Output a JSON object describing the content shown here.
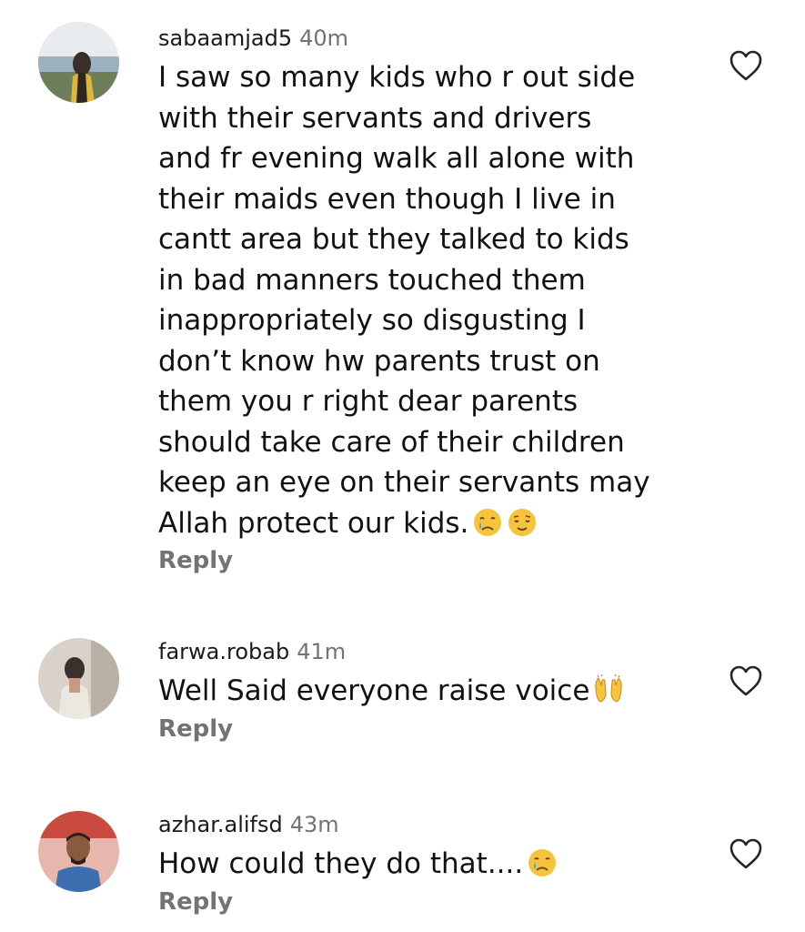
{
  "comments": [
    {
      "username": "sabaamjad5",
      "time": "40m",
      "text": "I saw so many kids who r out side\nwith their servants and drivers\nand fr evening walk all alone with\ntheir maids even though I live in\ncantt area but they talked to kids\nin bad manners touched them\ninappropriately so disgusting I\ndon’t know hw parents trust on\nthem you r right dear parents\nshould take care of their children\nkeep an eye on their servants may\nAllah protect our kids.",
      "emojis": [
        "crying-face",
        "relieved-face"
      ],
      "reply_label": "Reply",
      "like_icon": "heart-outline-icon"
    },
    {
      "username": "farwa.robab",
      "time": "41m",
      "text": "Well Said everyone raise voice",
      "emojis": [
        "raising-hands"
      ],
      "reply_label": "Reply",
      "like_icon": "heart-outline-icon"
    },
    {
      "username": "azhar.alifsd",
      "time": "43m",
      "text": "How could they do that....",
      "emojis": [
        "crying-face"
      ],
      "reply_label": "Reply",
      "like_icon": "heart-outline-icon"
    }
  ],
  "colors": {
    "text": "#111111",
    "secondary": "#737373",
    "background": "#ffffff",
    "emoji_yellow": "#f7c33c"
  }
}
